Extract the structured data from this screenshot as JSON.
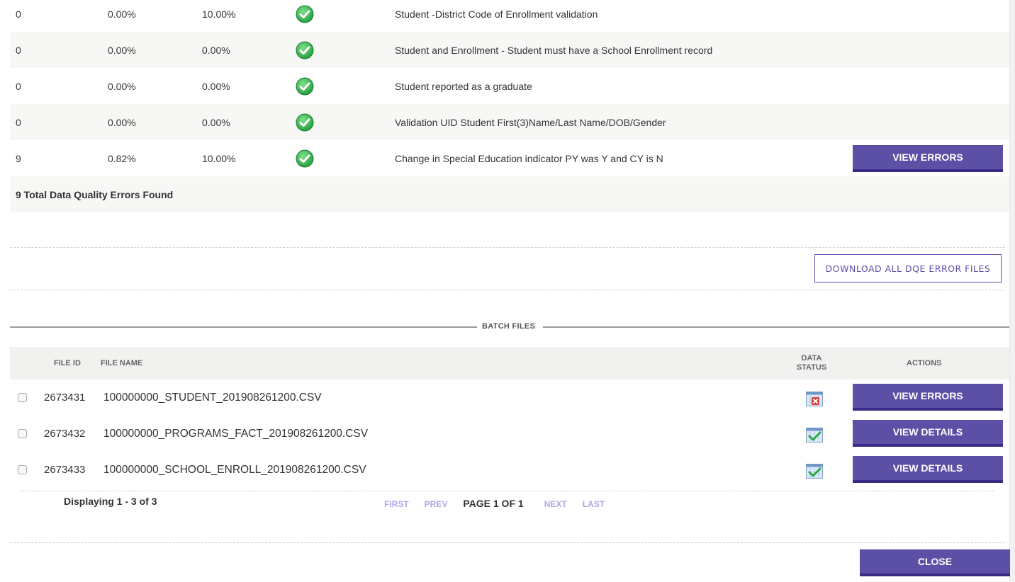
{
  "dq_rules": [
    {
      "count": "0",
      "percent": "0.00%",
      "threshold": "10.00%",
      "status_icon": "check-circle-icon",
      "description": "Student -District Code of Enrollment validation",
      "action": ""
    },
    {
      "count": "0",
      "percent": "0.00%",
      "threshold": "0.00%",
      "status_icon": "check-circle-icon",
      "description": "Student and Enrollment - Student must have a School Enrollment record",
      "action": ""
    },
    {
      "count": "0",
      "percent": "0.00%",
      "threshold": "0.00%",
      "status_icon": "check-circle-icon",
      "description": "Student reported as a graduate",
      "action": ""
    },
    {
      "count": "0",
      "percent": "0.00%",
      "threshold": "0.00%",
      "status_icon": "check-circle-icon",
      "description": "Validation UID Student First(3)Name/Last Name/DOB/Gender",
      "action": ""
    },
    {
      "count": "9",
      "percent": "0.82%",
      "threshold": "10.00%",
      "status_icon": "check-circle-icon",
      "description": "Change in Special Education indicator PY was Y and CY is N",
      "action": "VIEW ERRORS"
    }
  ],
  "total_errors_text": "9 Total Data Quality Errors Found",
  "download_all_label": "DOWNLOAD ALL DQE ERROR FILES",
  "batch_files": {
    "title": "BATCH FILES",
    "headers": {
      "file_id": "FILE ID",
      "file_name": "FILE NAME",
      "data_status_line1": "DATA",
      "data_status_line2": "STATUS",
      "actions": "ACTIONS"
    },
    "rows": [
      {
        "file_id": "2673431",
        "file_name": "100000000_STUDENT_201908261200.CSV",
        "status_icon": "file-error-icon",
        "action": "VIEW ERRORS"
      },
      {
        "file_id": "2673432",
        "file_name": "100000000_PROGRAMS_FACT_201908261200.CSV",
        "status_icon": "file-ok-icon",
        "action": "VIEW DETAILS"
      },
      {
        "file_id": "2673433",
        "file_name": "100000000_SCHOOL_ENROLL_201908261200.CSV",
        "status_icon": "file-ok-icon",
        "action": "VIEW DETAILS"
      }
    ]
  },
  "pagination": {
    "displaying": "Displaying 1 - 3 of 3",
    "first": "FIRST",
    "prev": "PREV",
    "current": "PAGE 1 OF 1",
    "next": "NEXT",
    "last": "LAST"
  },
  "close_label": "CLOSE",
  "colors": {
    "accent": "#5b4fa6",
    "accent_dark": "#3a2a86",
    "check_green": "#3cb371",
    "error_red": "#e03b3b",
    "pager_link": "#b7a6e8"
  }
}
